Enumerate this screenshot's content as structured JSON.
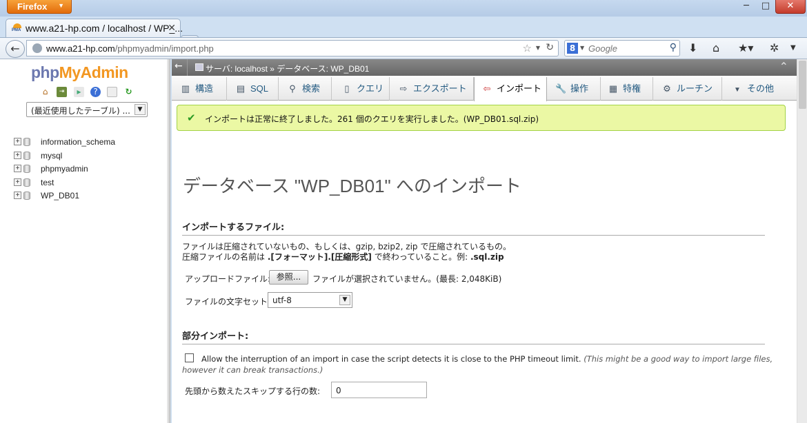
{
  "browser": {
    "app_button": "Firefox",
    "window_controls": {
      "minimize": "─",
      "maximize": "□",
      "close": "✕"
    },
    "tab": {
      "icon_text": "PMA",
      "title": "www.a21-hp.com / localhost / WP_..."
    },
    "new_tab": "+",
    "url": {
      "host": "www.a21-hp.com",
      "path": "/phpmyadmin/import.php"
    },
    "search": {
      "placeholder": "Google",
      "engine_letter": "8"
    }
  },
  "sidebar": {
    "logo": {
      "part1": "php",
      "part2": "MyAdmin"
    },
    "recent_tables": "(最近使用したテーブル) ...",
    "databases": [
      {
        "name": "information_schema"
      },
      {
        "name": "mysql"
      },
      {
        "name": "phpmyadmin"
      },
      {
        "name": "test"
      },
      {
        "name": "WP_DB01"
      }
    ]
  },
  "breadcrumb": {
    "text": "サーバ: localhost » データベース: WP_DB01"
  },
  "menu": [
    {
      "label": "構造"
    },
    {
      "label": "SQL"
    },
    {
      "label": "検索"
    },
    {
      "label": "クエリ"
    },
    {
      "label": "エクスポート"
    },
    {
      "label": "インポート"
    },
    {
      "label": "操作"
    },
    {
      "label": "特権"
    },
    {
      "label": "ルーチン"
    },
    {
      "label": "その他"
    }
  ],
  "success_message": "インポートは正常に終了しました。261 個のクエリを実行しました。(WP_DB01.sql.zip)",
  "page_title": "データベース \"WP_DB01\" へのインポート",
  "file_section": {
    "heading": "インポートするファイル:",
    "desc_line1": "ファイルは圧縮されていないもの、もしくは、gzip, bzip2, zip で圧縮されているもの。",
    "desc_line2_prefix": "圧縮ファイルの名前は ",
    "desc_line2_bold": ".[フォーマット].[圧縮形式]",
    "desc_line2_suffix": " で終わっていること。例: ",
    "desc_line2_example": ".sql.zip",
    "upload_label": "アップロードファイル:",
    "browse_button": "参照...",
    "no_file_text": "ファイルが選択されていません。(最長: 2,048KiB)",
    "charset_label": "ファイルの文字セット:",
    "charset_value": "utf-8"
  },
  "partial_section": {
    "heading": "部分インポート:",
    "allow_text": "Allow the interruption of an import in case the script detects it is close to the PHP timeout limit.",
    "allow_hint": "(This might be a good way to import large files, however it can break transactions.)",
    "skip_label": "先頭から数えたスキップする行の数:",
    "skip_value": "0"
  }
}
